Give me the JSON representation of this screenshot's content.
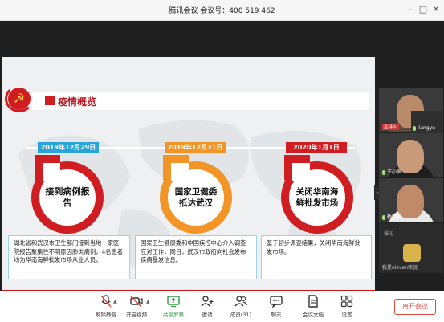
{
  "window": {
    "title": "腾讯会议 会议号：400 519 462"
  },
  "slide": {
    "title": "疫情概览",
    "events": [
      {
        "date": "2019年12月29日",
        "headline": "接到病例报告",
        "description": "湖北省和武汉市卫生部门接到当地一家医院报告聚集性不明原因肺炎病例，4名患者均为华南海鲜批发市场从业人员。"
      },
      {
        "date": "2019年12月31日",
        "headline": "国家卫健委抵达武汉",
        "description": "国家卫生健康委和中国疾控中心介入调查应对工作，同日，武汉市政府向社会发布疾病暴发信息。"
      },
      {
        "date": "2020年1月1日",
        "headline": "关闭华南海鲜批发市场",
        "description": "基于初步调查结果，关闭华南海鲜批发市场。"
      }
    ]
  },
  "participants": [
    {
      "name": "主持人",
      "host_badge": "主持人",
      "label": "主持人"
    },
    {
      "name": "liangyu"
    },
    {
      "name": "王小辰"
    },
    {
      "name": "杨胜宽"
    },
    {
      "name": "张沁"
    },
    {
      "name": "我是eleven新锐"
    }
  ],
  "toolbar": {
    "items": [
      {
        "label": "解除静音",
        "icon": "microphone-muted-icon"
      },
      {
        "label": "开启视频",
        "icon": "camera-off-icon"
      },
      {
        "label": "共享屏幕",
        "icon": "share-screen-icon"
      },
      {
        "label": "邀请",
        "icon": "invite-icon"
      },
      {
        "label": "成员(31)",
        "icon": "members-icon"
      },
      {
        "label": "聊天",
        "icon": "chat-icon"
      },
      {
        "label": "会议文档",
        "icon": "document-icon"
      },
      {
        "label": "设置",
        "icon": "settings-icon"
      }
    ],
    "end_button": "离开会议"
  },
  "colors": {
    "accent_red": "#d01d22",
    "accent_orange": "#f29426",
    "accent_blue": "#29a3d8",
    "active_green": "#2d9b3a"
  }
}
